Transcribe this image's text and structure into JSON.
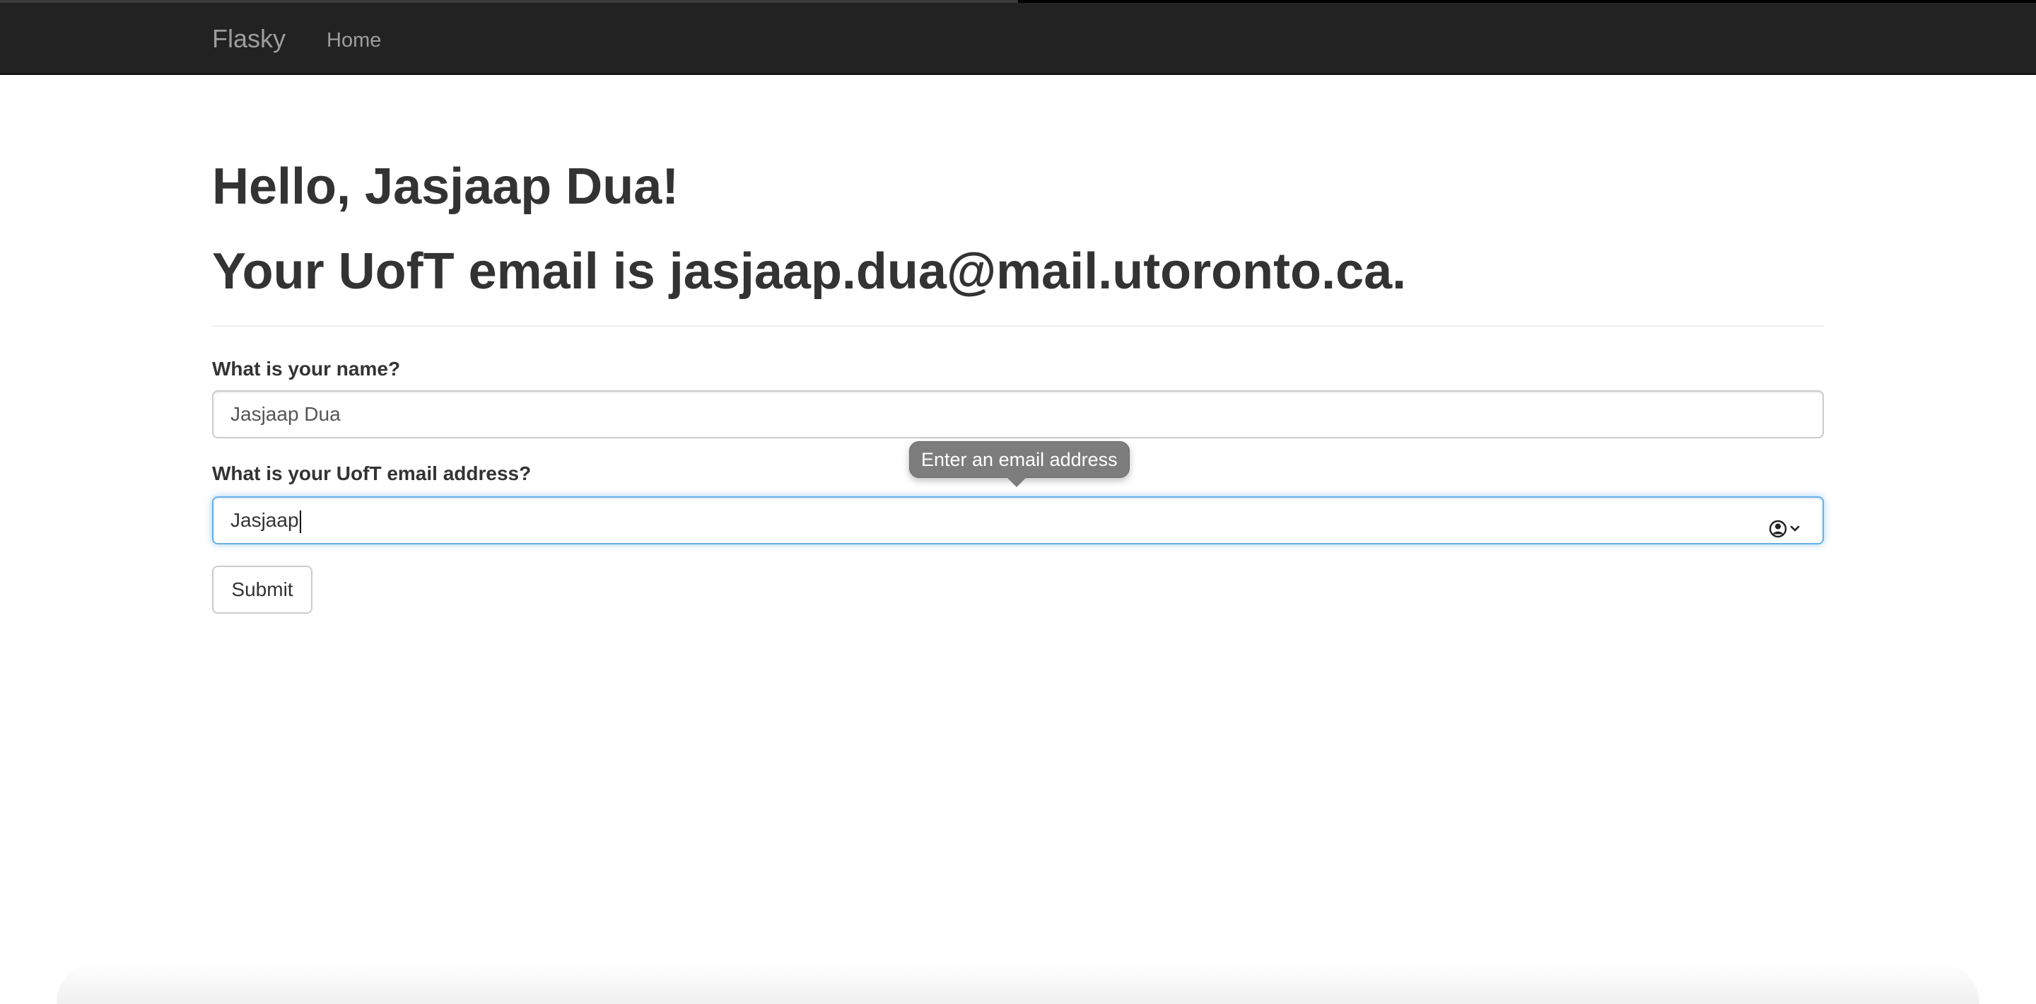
{
  "navbar": {
    "brand": "Flasky",
    "links": [
      {
        "label": "Home"
      }
    ]
  },
  "main": {
    "greeting": "Hello, Jasjaap Dua!",
    "email_message": "Your UofT email is jasjaap.dua@mail.utoronto.ca."
  },
  "form": {
    "name_label": "What is your name?",
    "name_value": "Jasjaap Dua",
    "email_label": "What is your UofT email address?",
    "email_value": "Jasjaap",
    "email_validation_tooltip": "Enter an email address",
    "submit_label": "Submit"
  },
  "page_load_progress": 0.5,
  "colors": {
    "navbar_bg": "#222222",
    "nav_text": "#9d9d9d",
    "heading_text": "#333333",
    "focus_border": "#66afe9",
    "tooltip_bg": "#7d7d7d"
  },
  "icons": {
    "autofill": "user-circle-chevron-icon"
  }
}
